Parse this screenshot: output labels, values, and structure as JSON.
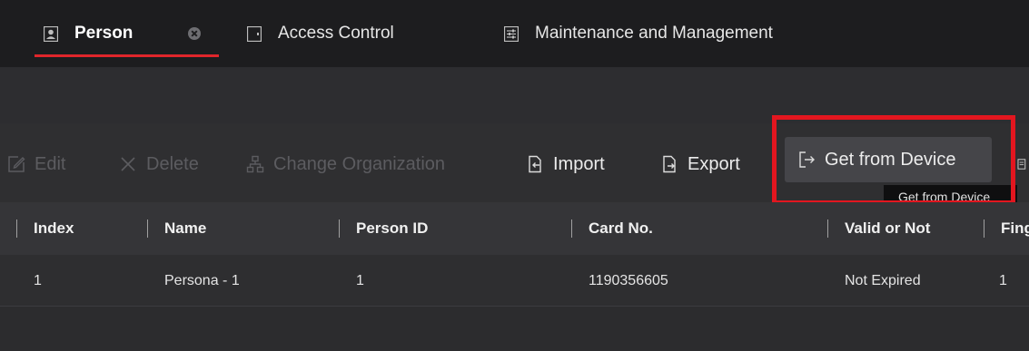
{
  "tabs": [
    {
      "label": "Person",
      "icon": "person-card-icon",
      "active": true,
      "closable": true
    },
    {
      "label": "Access Control",
      "icon": "door-icon",
      "active": false
    },
    {
      "label": "Maintenance and Management",
      "icon": "settings-panel-icon",
      "active": false
    }
  ],
  "toolbar": {
    "edit_label": "Edit",
    "delete_label": "Delete",
    "change_org_label": "Change Organization",
    "import_label": "Import",
    "export_label": "Export",
    "get_from_device_label": "Get from Device",
    "tooltip": "Get from Device"
  },
  "table": {
    "columns": [
      "Index",
      "Name",
      "Person ID",
      "Card No.",
      "Valid or Not",
      "Fing"
    ],
    "rows": [
      [
        "1",
        "Persona - 1",
        "1",
        "1190356605",
        "Not Expired",
        "1"
      ]
    ]
  },
  "colors": {
    "accent_red": "#e0262b",
    "highlight_red": "#e3161f",
    "background": "#2c2c2e"
  }
}
